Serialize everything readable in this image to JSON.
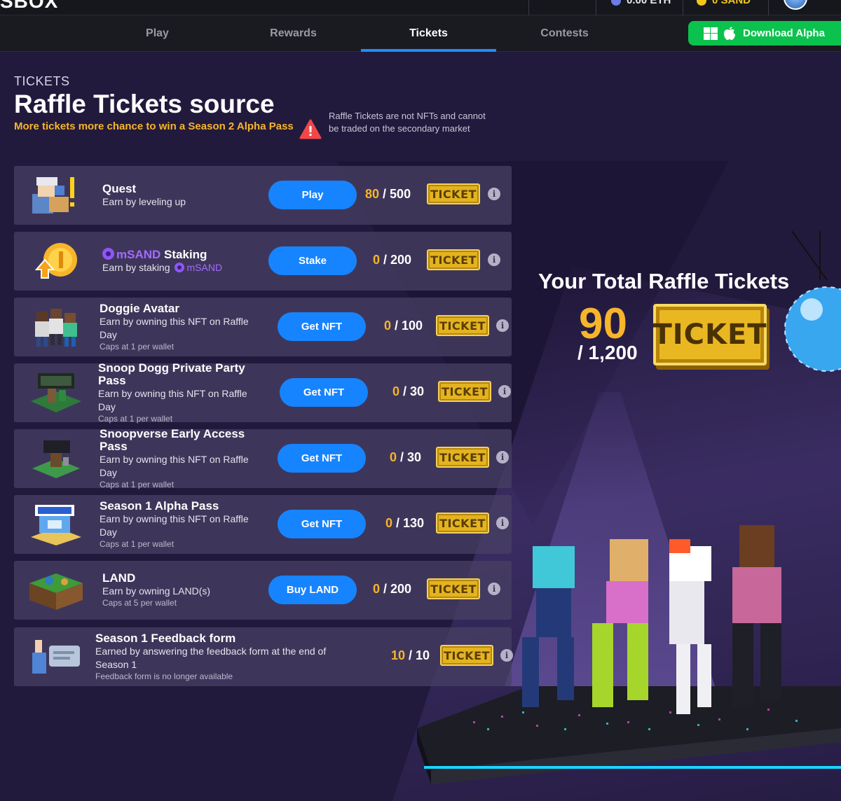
{
  "topbar": {
    "logo_fragment": "SBOX",
    "eth_balance": "0.00 ETH",
    "sand_balance": "0 SAND"
  },
  "nav": {
    "tabs": [
      {
        "label": "Play"
      },
      {
        "label": "Rewards"
      },
      {
        "label": "Tickets"
      },
      {
        "label": "Contests"
      }
    ],
    "active_tab": "Tickets",
    "download_label": "Download Alpha"
  },
  "header": {
    "kicker": "TICKETS",
    "title": "Raffle Tickets source",
    "subtitle": "More tickets more chance to win a Season 2 Alpha Pass",
    "warning": "Raffle Tickets are not NFTs and cannot be traded on the secondary market"
  },
  "ticket_label": "TICKET",
  "info_icon": "i",
  "rows": [
    {
      "title": "Quest",
      "desc": "Earn by leveling up",
      "cap": "",
      "button": "Play",
      "earned": "80",
      "max": "500",
      "icon": "quest-character-icon"
    },
    {
      "title_token": "mSAND",
      "title": "Staking",
      "desc": "Earn by staking",
      "desc_token": "mSAND",
      "cap": "",
      "button": "Stake",
      "earned": "0",
      "max": "200",
      "icon": "sand-coin-icon"
    },
    {
      "title": "Doggie Avatar",
      "desc": "Earn by owning this NFT on Raffle Day",
      "cap": "Caps at 1 per wallet",
      "button": "Get NFT",
      "earned": "0",
      "max": "100",
      "icon": "doggie-avatars-icon"
    },
    {
      "title": "Snoop Dogg Private Party Pass",
      "desc": "Earn by owning this NFT on Raffle Day",
      "cap": "Caps at 1 per wallet",
      "button": "Get NFT",
      "earned": "0",
      "max": "30",
      "icon": "private-party-pass-icon"
    },
    {
      "title": "Snoopverse Early Access Pass",
      "desc": "Earn by owning this NFT on Raffle Day",
      "cap": "Caps at 1 per wallet",
      "button": "Get NFT",
      "earned": "0",
      "max": "30",
      "icon": "early-access-pass-icon"
    },
    {
      "title": "Season 1 Alpha Pass",
      "desc": "Earn by owning this NFT on Raffle Day",
      "cap": "Caps at 1 per wallet",
      "button": "Get NFT",
      "earned": "0",
      "max": "130",
      "icon": "alpha-pass-icon"
    },
    {
      "title": "LAND",
      "desc": "Earn by owning LAND(s)",
      "cap": "Caps at 5 per wallet",
      "button": "Buy LAND",
      "earned": "0",
      "max": "200",
      "icon": "land-block-icon"
    },
    {
      "title": "Season 1 Feedback form",
      "desc": "Earned by answering the feedback form at the end of Season 1",
      "cap": "Feedback form is no longer available",
      "button": "",
      "earned": "10",
      "max": "10",
      "icon": "feedback-form-icon"
    }
  ],
  "total": {
    "title": "Your Total Raffle Tickets",
    "value": "90",
    "cap": "/ 1,200"
  },
  "colors": {
    "accent_blue": "#1784ff",
    "ticket_gold": "#e3b320",
    "earned_orange": "#f7b52b",
    "download_green": "#0cc24e",
    "msand_purple": "#a36bff"
  }
}
